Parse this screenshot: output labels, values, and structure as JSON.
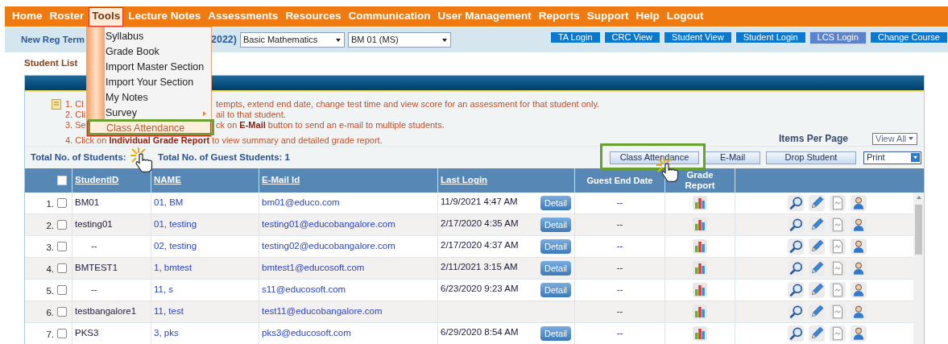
{
  "nav": {
    "items": [
      {
        "label": "Home",
        "selected": false
      },
      {
        "label": "Roster",
        "selected": false
      },
      {
        "label": "Tools",
        "selected": true
      },
      {
        "label": "Lecture Notes",
        "selected": false
      },
      {
        "label": "Assessments",
        "selected": false
      },
      {
        "label": "Resources",
        "selected": false
      },
      {
        "label": "Communication",
        "selected": false
      },
      {
        "label": "User Management",
        "selected": false
      },
      {
        "label": "Reports",
        "selected": false
      },
      {
        "label": "Support",
        "selected": false
      },
      {
        "label": "Help",
        "selected": false
      },
      {
        "label": "Logout",
        "selected": false
      }
    ]
  },
  "tools_menu": {
    "items": [
      {
        "label": "Syllabus",
        "selected": false,
        "has_submenu": false
      },
      {
        "label": "Grade Book",
        "selected": false,
        "has_submenu": false
      },
      {
        "label": "Import Master Section",
        "selected": false,
        "has_submenu": false
      },
      {
        "label": "Import Your Section",
        "selected": false,
        "has_submenu": false
      },
      {
        "label": "My Notes",
        "selected": false,
        "has_submenu": false
      },
      {
        "label": "Survey",
        "selected": false,
        "has_submenu": true
      },
      {
        "label": "Class Attendance",
        "selected": true,
        "has_submenu": false
      }
    ]
  },
  "course_bar": {
    "term_start": "New Reg Term",
    "term_end": "2022)",
    "course_select": "Basic Mathematics",
    "section_select": "BM 01 (MS)",
    "buttons": [
      {
        "label": "TA Login",
        "selected": false
      },
      {
        "label": "CRC View",
        "selected": false
      },
      {
        "label": "Student View",
        "selected": false
      },
      {
        "label": "Student Login",
        "selected": false
      },
      {
        "label": "LCS Login",
        "selected": true
      },
      {
        "label": "Change Course",
        "selected": false
      }
    ]
  },
  "page_title": "Student List",
  "instructions": [
    {
      "left": "1. Cl",
      "right": "tempts, extend end date, change test time and view score for an assessment for that student only."
    },
    {
      "left": "2. Cli",
      "right": "ail to that student."
    },
    {
      "left": "3. Se",
      "right": "ck on **E-Mail** button to send an e-mail to multiple students."
    },
    {
      "left": "4. Click on **Individual Grade Report** to view summary and detailed grade report."
    }
  ],
  "items_per_page": {
    "label": "Items Per Page",
    "value": "View All"
  },
  "totals": {
    "students": "Total No. of Students:",
    "guests": "Total No. of Guest Students: 1"
  },
  "actions": [
    "Class Attendance",
    "E-Mail",
    "Drop Student"
  ],
  "print_select": "Print",
  "table": {
    "select_all_checked": false,
    "columns": [
      {
        "label": "StudentID",
        "sortable": true
      },
      {
        "label": "NAME",
        "sortable": true
      },
      {
        "label": "E-Mail Id",
        "sortable": true
      },
      {
        "label": "Last Login",
        "sortable": true
      },
      {
        "label": "Guest End Date",
        "sortable": false
      },
      {
        "label": "Grade Report",
        "sortable": false
      }
    ],
    "rows": [
      {
        "number": "1.",
        "checked": false,
        "student_id": "BM01",
        "name": "01, BM",
        "email": "bm01@educo.com",
        "last_login": "11/9/2021 4:47 AM",
        "detail": "Detail",
        "guest_end_date": "--"
      },
      {
        "number": "2.",
        "checked": false,
        "student_id": "testing01",
        "name": "01, testing",
        "email": "testing01@educobangalore.com",
        "last_login": "2/17/2020 4:35 AM",
        "detail": "Detail",
        "guest_end_date": "--"
      },
      {
        "number": "3.",
        "checked": false,
        "student_id": "--",
        "name": "02, testing",
        "email": "testing02@educobangalore.com",
        "last_login": "2/17/2020 4:37 AM",
        "detail": "Detail",
        "guest_end_date": "--"
      },
      {
        "number": "4.",
        "checked": false,
        "student_id": "BMTEST1",
        "name": "1, bmtest",
        "email": "bmtest1@educosoft.com",
        "last_login": "2/11/2021 3:15 AM",
        "detail": "Detail",
        "guest_end_date": "--"
      },
      {
        "number": "5.",
        "checked": false,
        "student_id": "--",
        "name": "11, s",
        "email": "s11@educosoft.com",
        "last_login": "6/23/2020 9:23 AM",
        "detail": "Detail",
        "guest_end_date": "--"
      },
      {
        "number": "6.",
        "checked": false,
        "student_id": "testbangalore1",
        "name": "11, test",
        "email": "test11@educobangalore.com",
        "guest_end_date": "--"
      },
      {
        "number": "7.",
        "checked": false,
        "student_id": "PKS3",
        "name": "3, pks",
        "email": "pks3@educosoft.com",
        "last_login": "6/29/2020 8:54 AM",
        "detail": "Detail",
        "guest_end_date": "--"
      }
    ]
  }
}
